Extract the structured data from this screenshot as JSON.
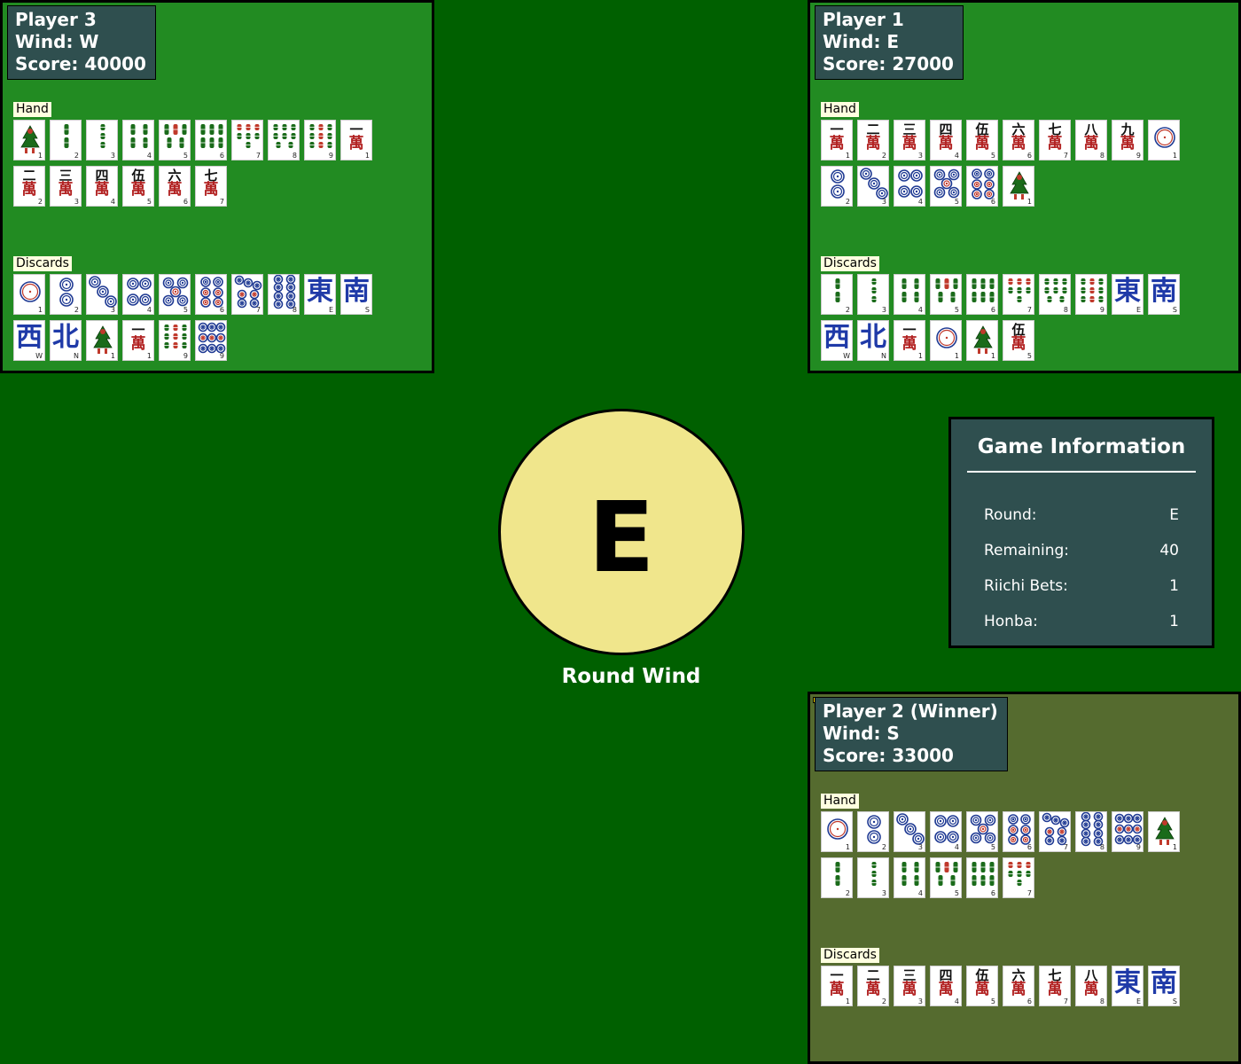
{
  "colors": {
    "table": "#006000",
    "panel": "#228b22",
    "winner_panel": "#556b2f",
    "info_box": "#2f4f4f",
    "center": "#f0e68c",
    "label_bg": "#ffffe0",
    "winner_flag": "#ffd700",
    "man": "#b22222",
    "sou": "#1a6b1a",
    "pin": "#1f3a93",
    "wind": "#1f3aa8"
  },
  "section_labels": {
    "hand": "Hand",
    "discards": "Discards"
  },
  "players": {
    "player3": {
      "name": "Player 3",
      "wind": "Wind: W",
      "score": "Score: 40000",
      "winner": false,
      "hand": [
        {
          "suit": "sou",
          "n": 1
        },
        {
          "suit": "sou",
          "n": 2
        },
        {
          "suit": "sou",
          "n": 3
        },
        {
          "suit": "sou",
          "n": 4
        },
        {
          "suit": "sou",
          "n": 5
        },
        {
          "suit": "sou",
          "n": 6
        },
        {
          "suit": "sou",
          "n": 7
        },
        {
          "suit": "sou",
          "n": 8
        },
        {
          "suit": "sou",
          "n": 9
        },
        {
          "suit": "man",
          "n": 1
        },
        {
          "suit": "man",
          "n": 2
        },
        {
          "suit": "man",
          "n": 3
        },
        {
          "suit": "man",
          "n": 4
        },
        {
          "suit": "man",
          "n": 5
        },
        {
          "suit": "man",
          "n": 6
        },
        {
          "suit": "man",
          "n": 7
        }
      ],
      "discards": [
        {
          "suit": "pin",
          "n": 1
        },
        {
          "suit": "pin",
          "n": 2
        },
        {
          "suit": "pin",
          "n": 3
        },
        {
          "suit": "pin",
          "n": 4
        },
        {
          "suit": "pin",
          "n": 5
        },
        {
          "suit": "pin",
          "n": 6
        },
        {
          "suit": "pin",
          "n": 7
        },
        {
          "suit": "pin",
          "n": 8
        },
        {
          "suit": "wind",
          "w": "E"
        },
        {
          "suit": "wind",
          "w": "S"
        },
        {
          "suit": "wind",
          "w": "W"
        },
        {
          "suit": "wind",
          "w": "N"
        },
        {
          "suit": "sou",
          "n": 1
        },
        {
          "suit": "man",
          "n": 1
        },
        {
          "suit": "sou",
          "n": 9
        },
        {
          "suit": "pin",
          "n": 9
        }
      ]
    },
    "player1": {
      "name": "Player 1",
      "wind": "Wind: E",
      "score": "Score: 27000",
      "winner": false,
      "hand": [
        {
          "suit": "man",
          "n": 1
        },
        {
          "suit": "man",
          "n": 2
        },
        {
          "suit": "man",
          "n": 3
        },
        {
          "suit": "man",
          "n": 4
        },
        {
          "suit": "man",
          "n": 5
        },
        {
          "suit": "man",
          "n": 6
        },
        {
          "suit": "man",
          "n": 7
        },
        {
          "suit": "man",
          "n": 8
        },
        {
          "suit": "man",
          "n": 9
        },
        {
          "suit": "pin",
          "n": 1
        },
        {
          "suit": "pin",
          "n": 2
        },
        {
          "suit": "pin",
          "n": 3
        },
        {
          "suit": "pin",
          "n": 4
        },
        {
          "suit": "pin",
          "n": 5
        },
        {
          "suit": "pin",
          "n": 6
        },
        {
          "suit": "sou",
          "n": 1
        }
      ],
      "discards": [
        {
          "suit": "sou",
          "n": 2
        },
        {
          "suit": "sou",
          "n": 3
        },
        {
          "suit": "sou",
          "n": 4
        },
        {
          "suit": "sou",
          "n": 5
        },
        {
          "suit": "sou",
          "n": 6
        },
        {
          "suit": "sou",
          "n": 7
        },
        {
          "suit": "sou",
          "n": 8
        },
        {
          "suit": "sou",
          "n": 9
        },
        {
          "suit": "wind",
          "w": "E"
        },
        {
          "suit": "wind",
          "w": "S"
        },
        {
          "suit": "wind",
          "w": "W"
        },
        {
          "suit": "wind",
          "w": "N"
        },
        {
          "suit": "man",
          "n": 1
        },
        {
          "suit": "pin",
          "n": 1
        },
        {
          "suit": "sou",
          "n": 1
        },
        {
          "suit": "man",
          "n": 5
        }
      ]
    },
    "player2": {
      "name": "Player 2 (Winner)",
      "wind": "Wind: S",
      "score": "Score: 33000",
      "winner": true,
      "hand": [
        {
          "suit": "pin",
          "n": 1
        },
        {
          "suit": "pin",
          "n": 2
        },
        {
          "suit": "pin",
          "n": 3
        },
        {
          "suit": "pin",
          "n": 4
        },
        {
          "suit": "pin",
          "n": 5
        },
        {
          "suit": "pin",
          "n": 6
        },
        {
          "suit": "pin",
          "n": 7
        },
        {
          "suit": "pin",
          "n": 8
        },
        {
          "suit": "pin",
          "n": 9
        },
        {
          "suit": "sou",
          "n": 1
        },
        {
          "suit": "sou",
          "n": 2
        },
        {
          "suit": "sou",
          "n": 3
        },
        {
          "suit": "sou",
          "n": 4
        },
        {
          "suit": "sou",
          "n": 5
        },
        {
          "suit": "sou",
          "n": 6
        },
        {
          "suit": "sou",
          "n": 7
        }
      ],
      "discards": [
        {
          "suit": "man",
          "n": 1
        },
        {
          "suit": "man",
          "n": 2
        },
        {
          "suit": "man",
          "n": 3
        },
        {
          "suit": "man",
          "n": 4
        },
        {
          "suit": "man",
          "n": 5
        },
        {
          "suit": "man",
          "n": 6
        },
        {
          "suit": "man",
          "n": 7
        },
        {
          "suit": "man",
          "n": 8
        },
        {
          "suit": "wind",
          "w": "E"
        },
        {
          "suit": "wind",
          "w": "S"
        }
      ]
    }
  },
  "round": {
    "wind": "E",
    "label": "Round Wind"
  },
  "game_info": {
    "title": "Game Information",
    "rows": [
      {
        "label": "Round:",
        "value": "E"
      },
      {
        "label": "Remaining:",
        "value": "40"
      },
      {
        "label": "Riichi Bets:",
        "value": "1"
      },
      {
        "label": "Honba:",
        "value": "1"
      }
    ]
  }
}
